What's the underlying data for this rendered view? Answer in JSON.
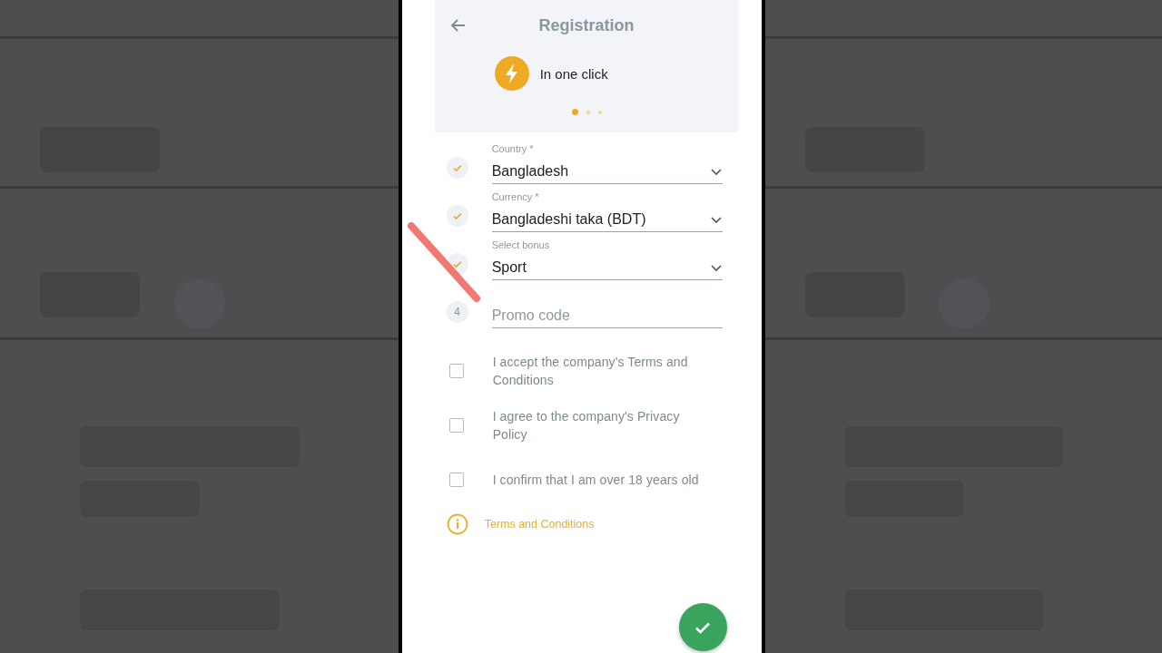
{
  "header": {
    "title": "Registration",
    "slide_label": "In one click",
    "slides": [
      {
        "selected": true
      },
      {
        "selected": false
      },
      {
        "selected": false
      }
    ]
  },
  "fields": [
    {
      "kind": "select",
      "completed": true,
      "label": "Country *",
      "value": "Bangladesh"
    },
    {
      "kind": "select",
      "completed": true,
      "label": "Currency *",
      "value": "Bangladeshi taka (BDT)"
    },
    {
      "kind": "select",
      "completed": true,
      "label": "Select bonus",
      "value": "Sport"
    },
    {
      "kind": "input",
      "completed": false,
      "step": "4",
      "placeholder": "Promo code"
    }
  ],
  "agreements": [
    {
      "label": "I accept the company's Terms and Conditions",
      "checked": false
    },
    {
      "label": "I agree to the company's Privacy Policy",
      "checked": false
    },
    {
      "label": "I confirm that I am over 18 years old",
      "checked": false
    }
  ],
  "terms_link": "Terms and Conditions"
}
